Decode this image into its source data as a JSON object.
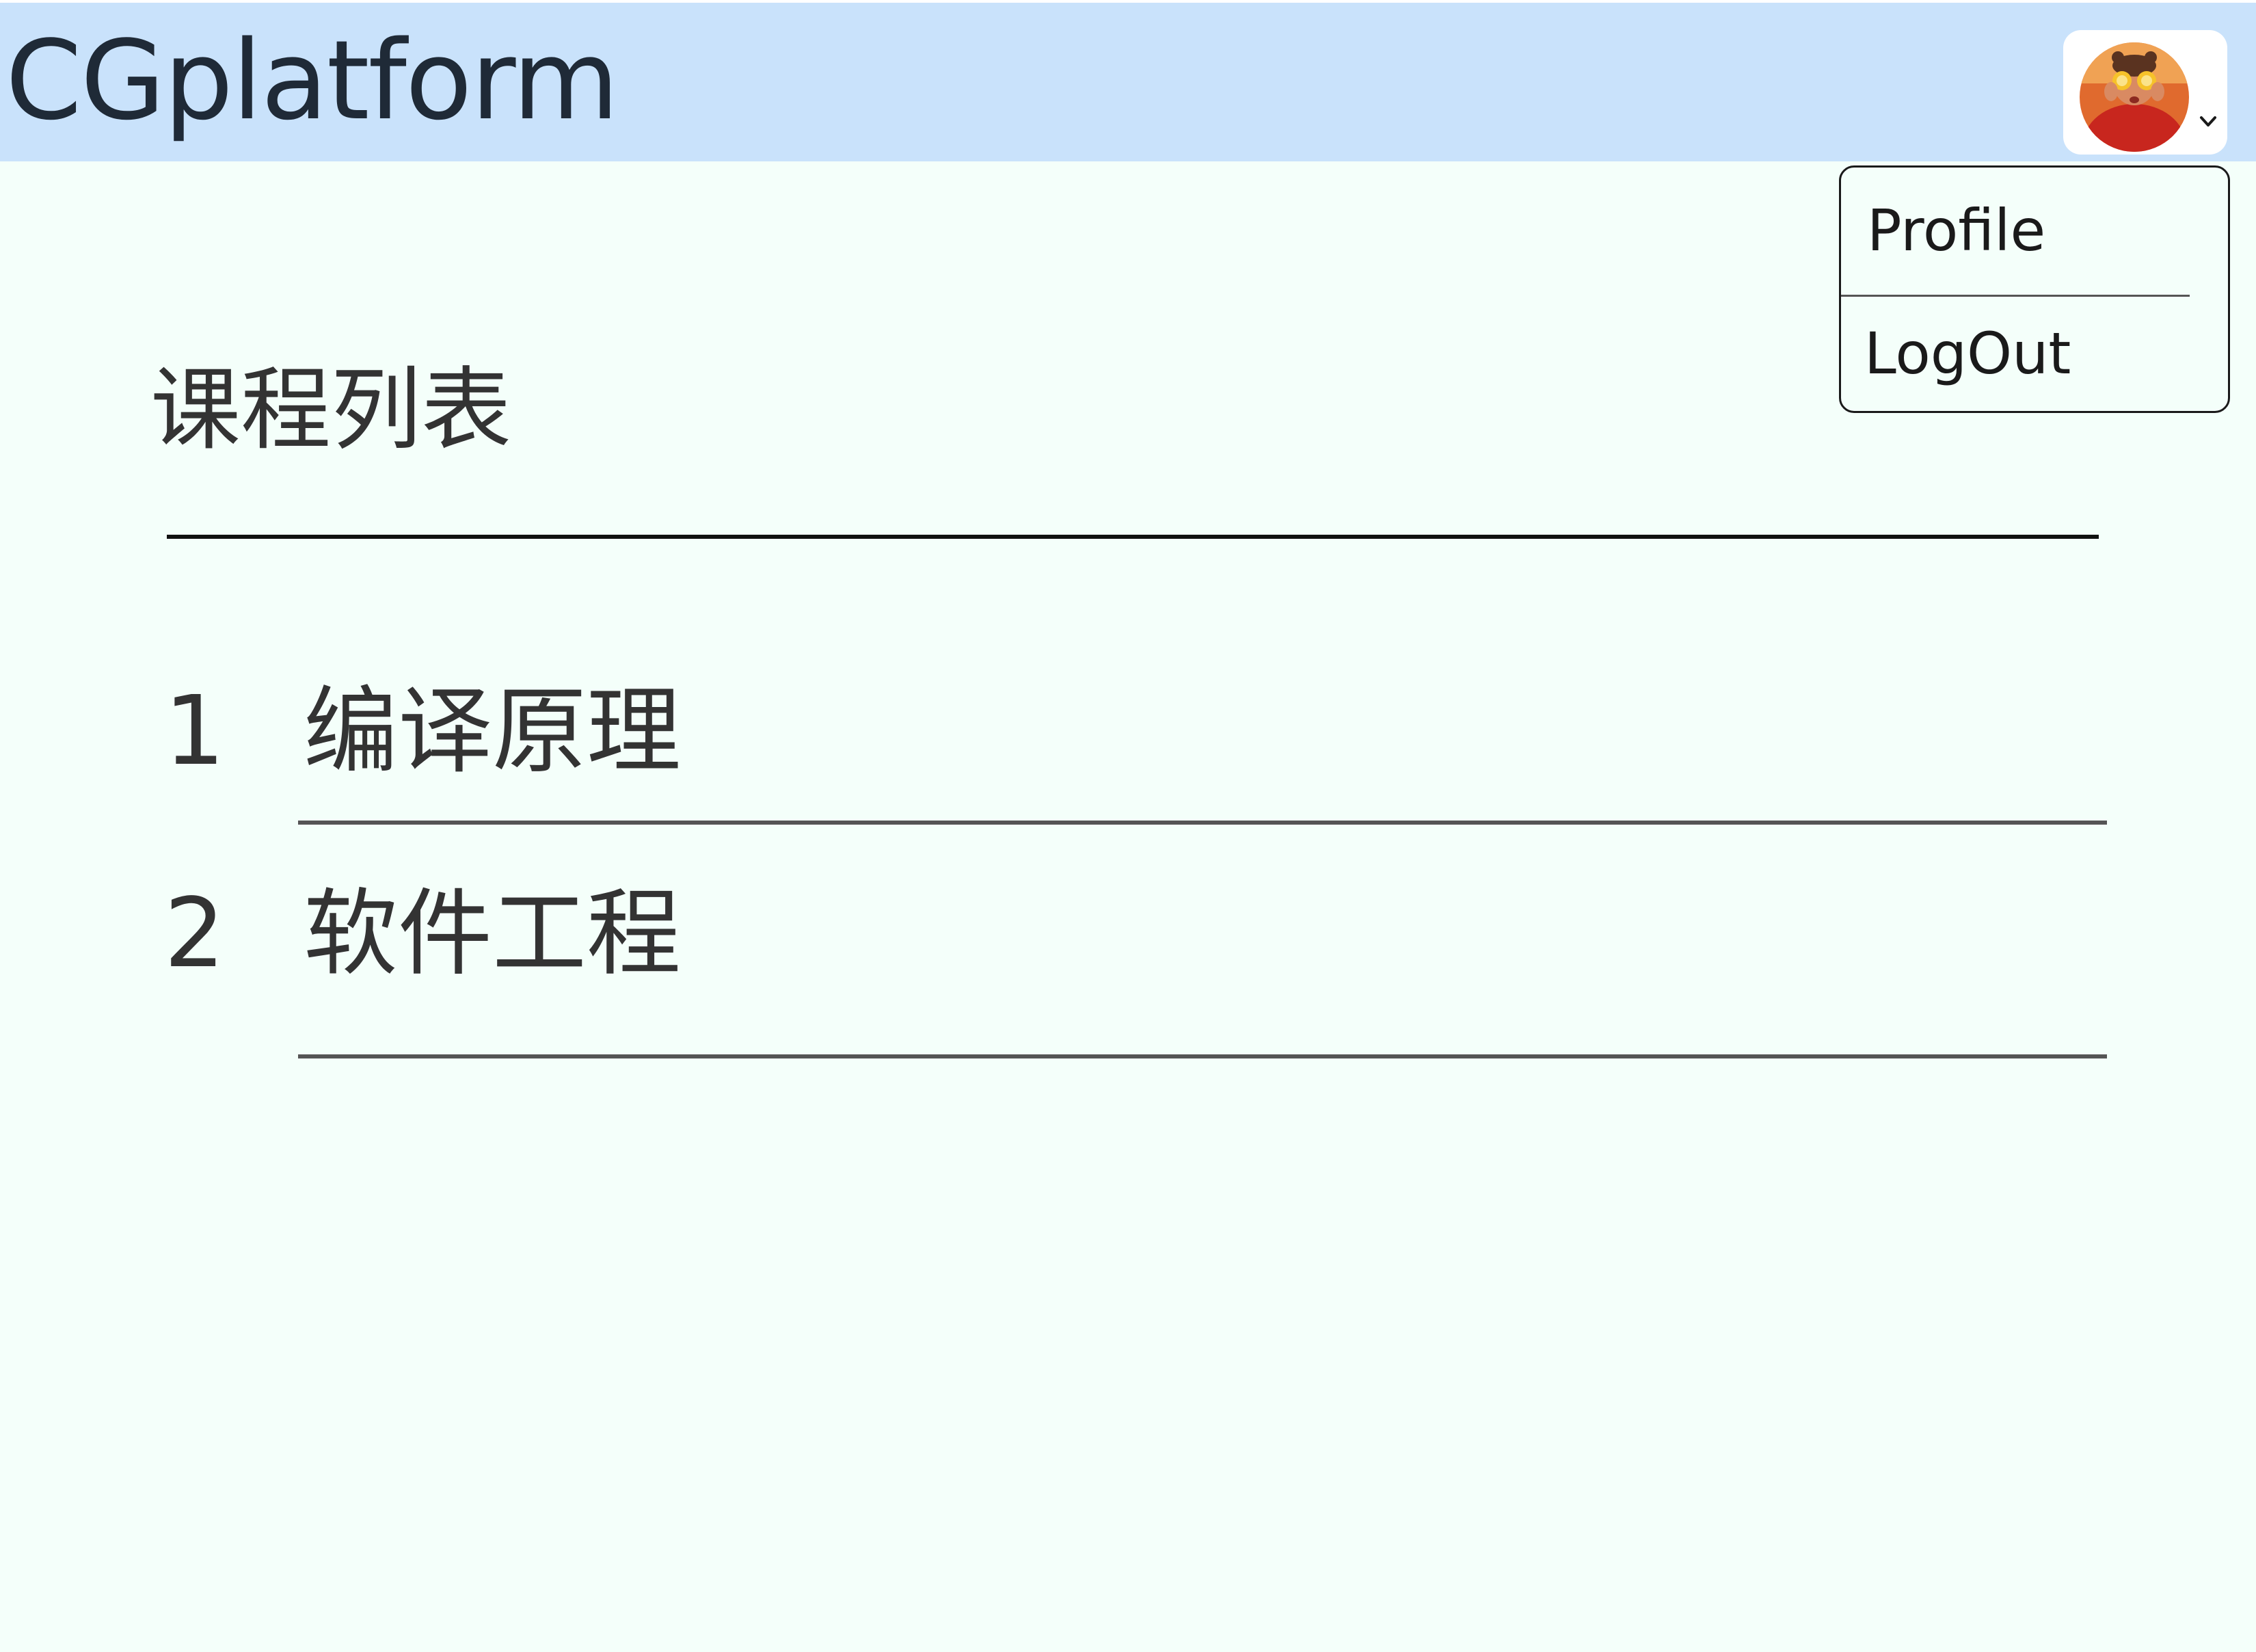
{
  "header": {
    "app_title": "CGplatform",
    "user_menu": {
      "avatar_icon": "avatar-photo",
      "chevron_icon": "chevron-down-icon"
    }
  },
  "dropdown": {
    "items": [
      {
        "label": "Profile"
      },
      {
        "label": "LogOut"
      }
    ]
  },
  "main": {
    "title": "课程列表",
    "courses": [
      {
        "index": "1",
        "name": "编译原理"
      },
      {
        "index": "2",
        "name": "软件工程"
      }
    ]
  },
  "colors": {
    "header_bg": "#c9e2fb",
    "page_bg": "#f4fffa",
    "text": "#333333"
  }
}
